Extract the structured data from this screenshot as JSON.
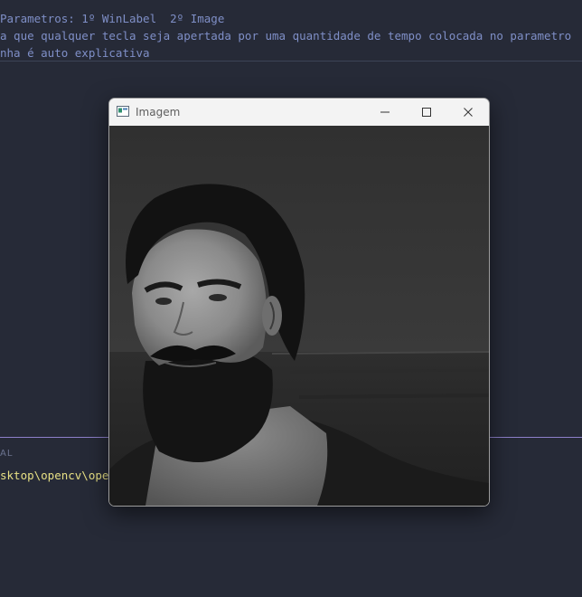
{
  "editor": {
    "lines": [
      "Parametros: 1º WinLabel  2º Image",
      "a que qualquer tecla seja apertada por uma quantidade de tempo colocada no parametro",
      "nha é auto explicativa"
    ]
  },
  "panel": {
    "label": "AL",
    "terminal_line": "sktop\\opencv\\ope"
  },
  "window": {
    "title": "Imagem",
    "icon": "opencv-window-icon",
    "controls": [
      "minimize-icon",
      "maximize-icon",
      "close-icon"
    ]
  },
  "image": {
    "description_icon": "grayscale-portrait",
    "tones": {
      "sky": "#3b3b3b",
      "sea": "#2a2a2a",
      "hair": "#141414",
      "skin": "#9a9a9a",
      "shirt": "#1c1c1c"
    }
  },
  "colors": {
    "editor_bg": "#262a37",
    "code_text": "#7f8fc7",
    "terminal_text": "#e7e084",
    "panel_border": "#8d7fc9"
  }
}
